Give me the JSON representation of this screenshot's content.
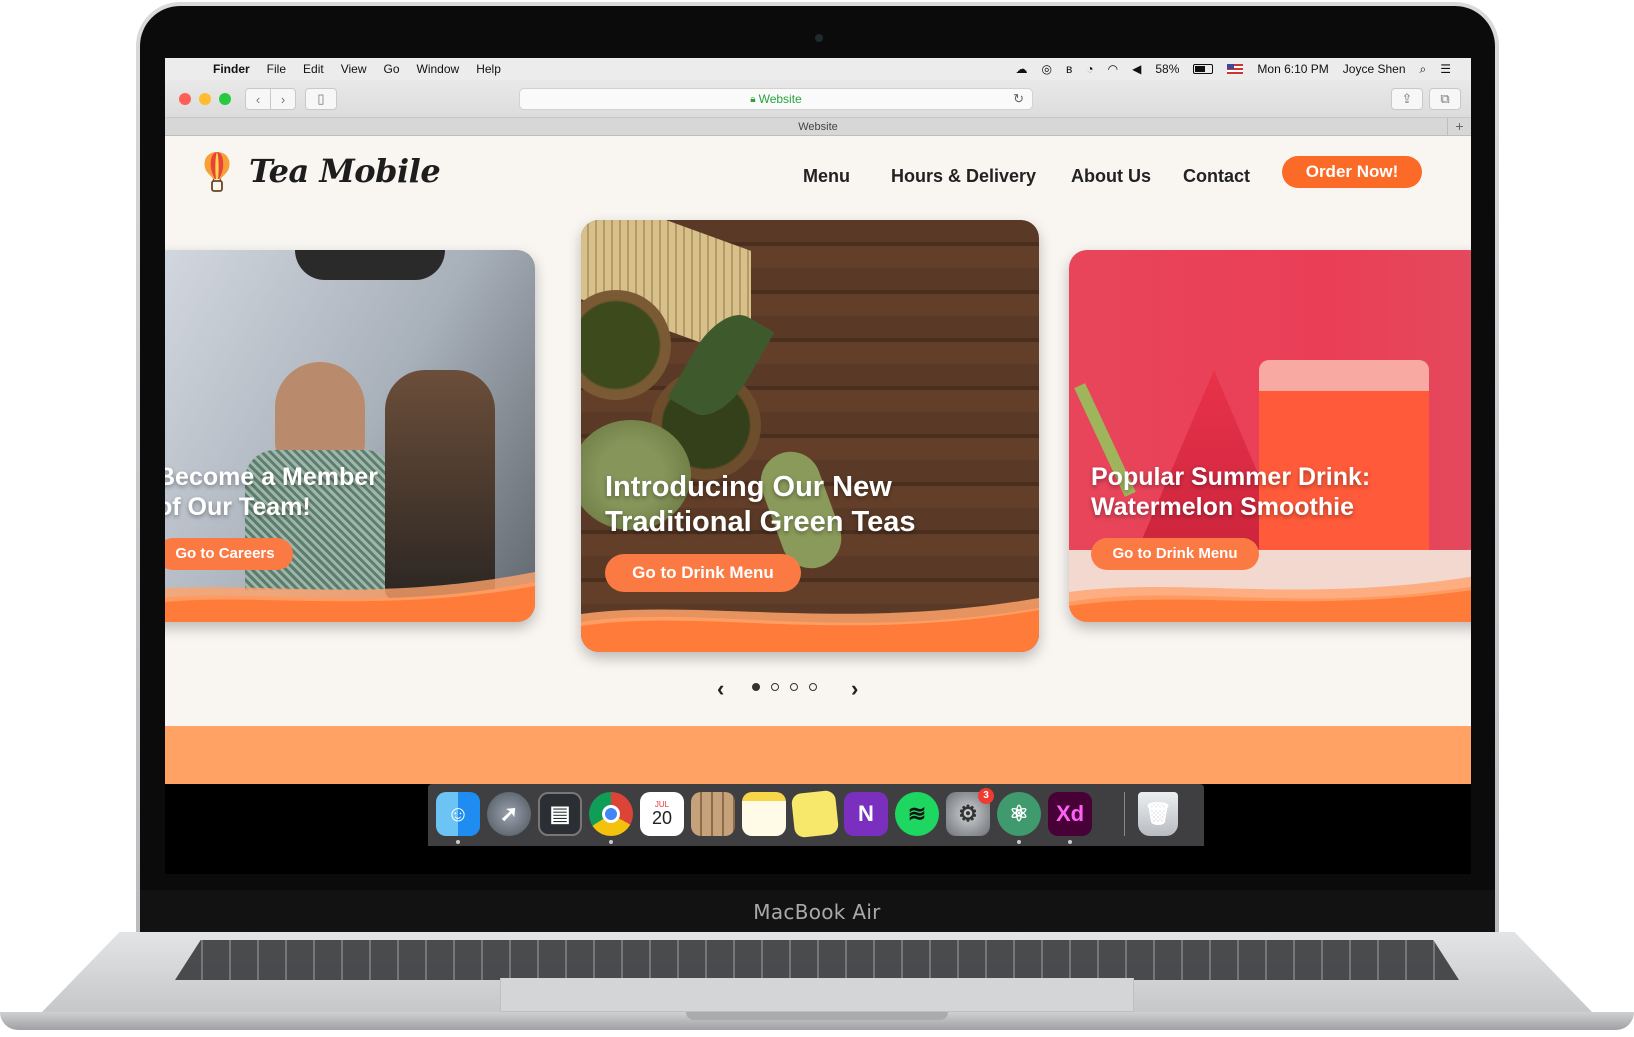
{
  "menubar": {
    "apple_icon": "apple-icon",
    "app": "Finder",
    "items": [
      "File",
      "Edit",
      "View",
      "Go",
      "Window",
      "Help"
    ],
    "battery": "58%",
    "clock": "Mon 6:10 PM",
    "user": "Joyce Shen"
  },
  "browser": {
    "url": "Website",
    "tab_title": "Website",
    "new_tab": "+"
  },
  "site": {
    "brand": "Tea Mobile",
    "nav": [
      "Menu",
      "Hours & Delivery",
      "About Us",
      "Contact"
    ],
    "cta": "Order Now!",
    "accent": "#fb6b27",
    "band_color": "#ffa264",
    "cards": [
      {
        "title_line1": "Become a Member",
        "title_line2": "of Our Team!",
        "button": "Go to Careers"
      },
      {
        "title_line1": "Introducing Our New",
        "title_line2": "Traditional Green Teas",
        "button": "Go to Drink Menu"
      },
      {
        "title_line1": "Popular Summer Drink:",
        "title_line2": "Watermelon Smoothie",
        "button": "Go to Drink Menu"
      }
    ],
    "carousel": {
      "prev": "‹",
      "next": "›",
      "active_index": 0,
      "count": 4
    }
  },
  "dock": {
    "calendar_month": "JUL",
    "calendar_day": "20",
    "prefs_badge": "3",
    "xd_label": "Xd",
    "onenote_label": "N"
  },
  "device_label": "MacBook Air"
}
